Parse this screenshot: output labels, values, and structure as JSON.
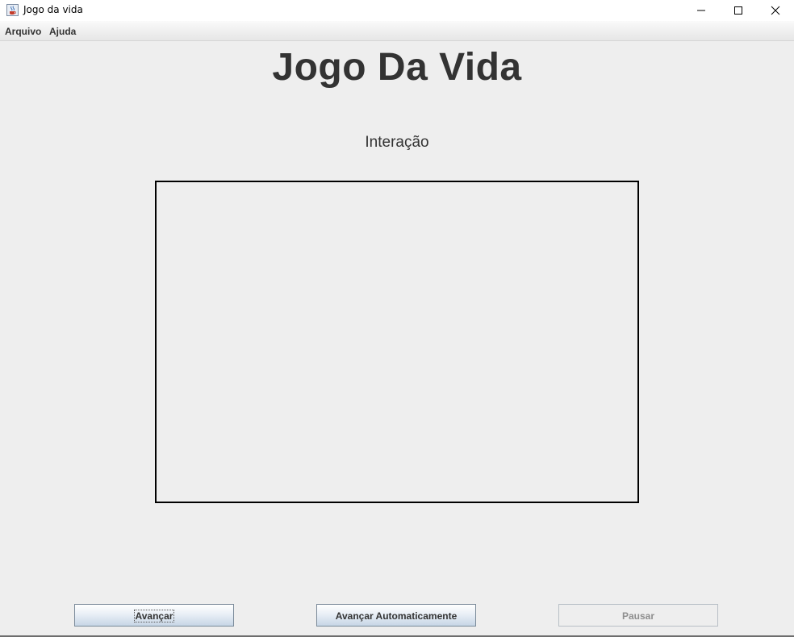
{
  "window": {
    "title": "Jogo da vida"
  },
  "menu": {
    "items": [
      {
        "label": "Arquivo"
      },
      {
        "label": "Ajuda"
      }
    ]
  },
  "main": {
    "heading": "Jogo Da Vida",
    "iteration_label": "Interação"
  },
  "buttons": {
    "advance": "Avançar",
    "auto_advance": "Avançar Automaticamente",
    "pause": "Pausar"
  },
  "state": {
    "pause_enabled": false,
    "focused_button": "advance"
  },
  "icons": {
    "app": "java-cup-icon",
    "minimize": "minimize-icon",
    "maximize": "maximize-icon",
    "close": "close-icon"
  }
}
